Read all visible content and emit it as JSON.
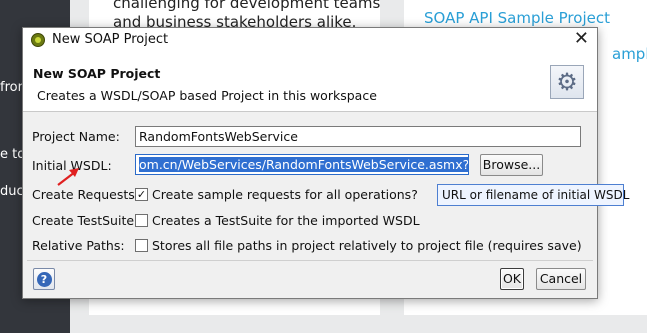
{
  "background": {
    "left_fragments": [
      "fron",
      "e to",
      "duct"
    ],
    "middle_fragments": [
      "challenging for development teams",
      "and business stakeholders alike."
    ],
    "right_fragments": [
      "SOAP API Sample Project",
      "ample"
    ]
  },
  "dialog": {
    "window_title": "New SOAP Project",
    "header": {
      "title": "New SOAP Project",
      "description": "Creates a WSDL/SOAP based Project in this workspace"
    },
    "fields": {
      "project_name_label": "Project Name:",
      "project_name_value": "RandomFontsWebService",
      "initial_wsdl_label": "Initial WSDL:",
      "initial_wsdl_value": "om.cn/WebServices/RandomFontsWebService.asmx?wsdl",
      "browse_label": "Browse..."
    },
    "options": [
      {
        "label": "Create Requests:",
        "checkbox_text": "Create sample requests for all operations?",
        "checked": true
      },
      {
        "label": "Create TestSuite:",
        "checkbox_text": "Creates a TestSuite for the imported WSDL",
        "checked": false
      },
      {
        "label": "Relative Paths:",
        "checkbox_text": "Stores all file paths in project relatively to project file (requires save)",
        "checked": false
      }
    ],
    "buttons": {
      "ok": "OK",
      "cancel": "Cancel"
    },
    "tooltip": "URL or filename of initial WSDL"
  },
  "icons": {
    "close": "close-icon",
    "gear": "gear-icon",
    "help": "help-icon",
    "checkmark": "✓",
    "annotation_arrow_color": "#e02020"
  }
}
